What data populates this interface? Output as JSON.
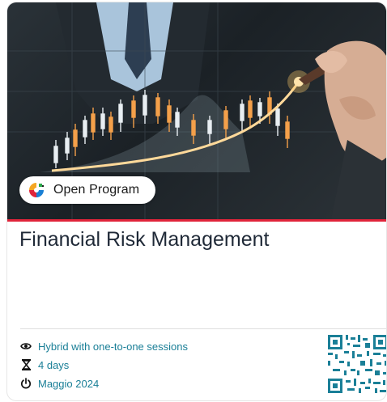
{
  "program": {
    "badge_label": "Open Program",
    "title": "Financial Risk Management"
  },
  "meta": {
    "format": "Hybrid with one-to-one sessions",
    "duration": "4 days",
    "start": "Maggio 2024"
  },
  "icons": {
    "format_icon": "eye-icon",
    "duration_icon": "hourglass-icon",
    "start_icon": "power-icon",
    "badge_logo": "brand-logo-icon"
  },
  "colors": {
    "accent_line": "#e0243a",
    "meta_text": "#1a7f97",
    "qr": "#1a7f97"
  }
}
